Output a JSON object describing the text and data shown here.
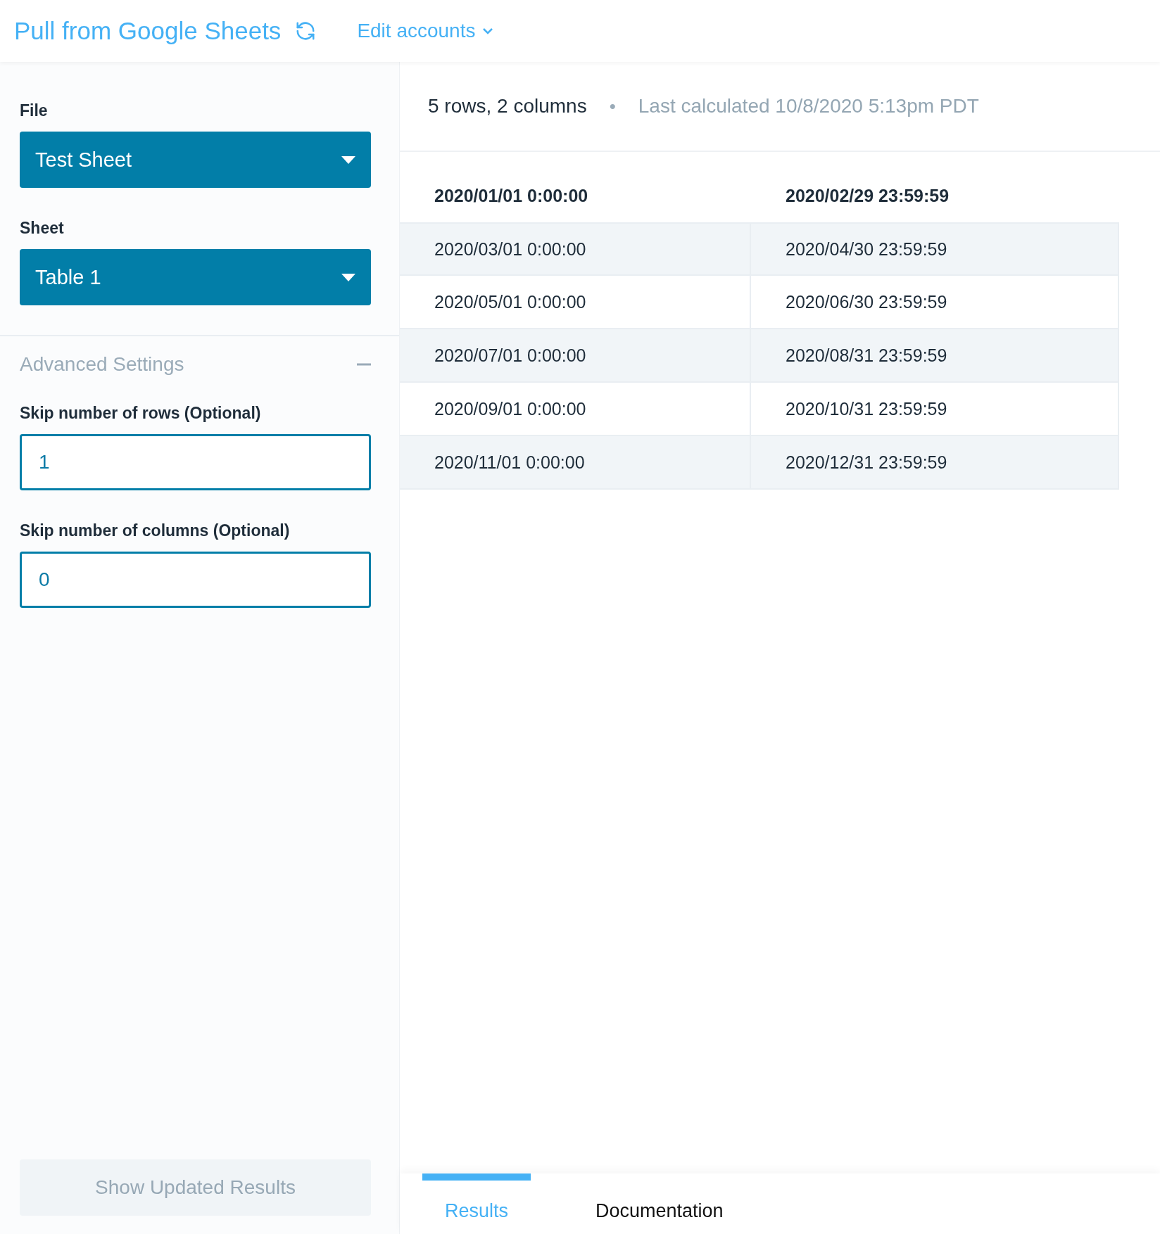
{
  "header": {
    "title": "Pull from Google Sheets",
    "accounts_menu": "Edit accounts"
  },
  "sidebar": {
    "fields": [
      {
        "kind": "select",
        "label": "File",
        "value": "Test Sheet"
      },
      {
        "kind": "select",
        "label": "Sheet",
        "value": "Table 1"
      }
    ],
    "advanced": {
      "title": "Advanced Settings",
      "expanded": true,
      "fields": [
        {
          "kind": "input",
          "label": "Skip number of rows (Optional)",
          "value": "1"
        },
        {
          "kind": "input",
          "label": "Skip number of columns (Optional)",
          "value": "0"
        }
      ]
    },
    "submit": {
      "label": "Show Updated Results",
      "disabled": true
    }
  },
  "results": {
    "summary": "5 rows, 2 columns",
    "separator": "•",
    "last_calculated": "Last calculated 10/8/2020 5:13pm PDT",
    "table": {
      "columns": [
        "2020/01/01 0:00:00",
        "2020/02/29 23:59:59"
      ],
      "rows": [
        [
          "2020/03/01 0:00:00",
          "2020/04/30 23:59:59"
        ],
        [
          "2020/05/01 0:00:00",
          "2020/06/30 23:59:59"
        ],
        [
          "2020/07/01 0:00:00",
          "2020/08/31 23:59:59"
        ],
        [
          "2020/09/01 0:00:00",
          "2020/10/31 23:59:59"
        ],
        [
          "2020/11/01 0:00:00",
          "2020/12/31 23:59:59"
        ]
      ]
    }
  },
  "tabs": [
    {
      "label": "Results",
      "selected": true
    },
    {
      "label": "Documentation",
      "selected": false
    }
  ]
}
